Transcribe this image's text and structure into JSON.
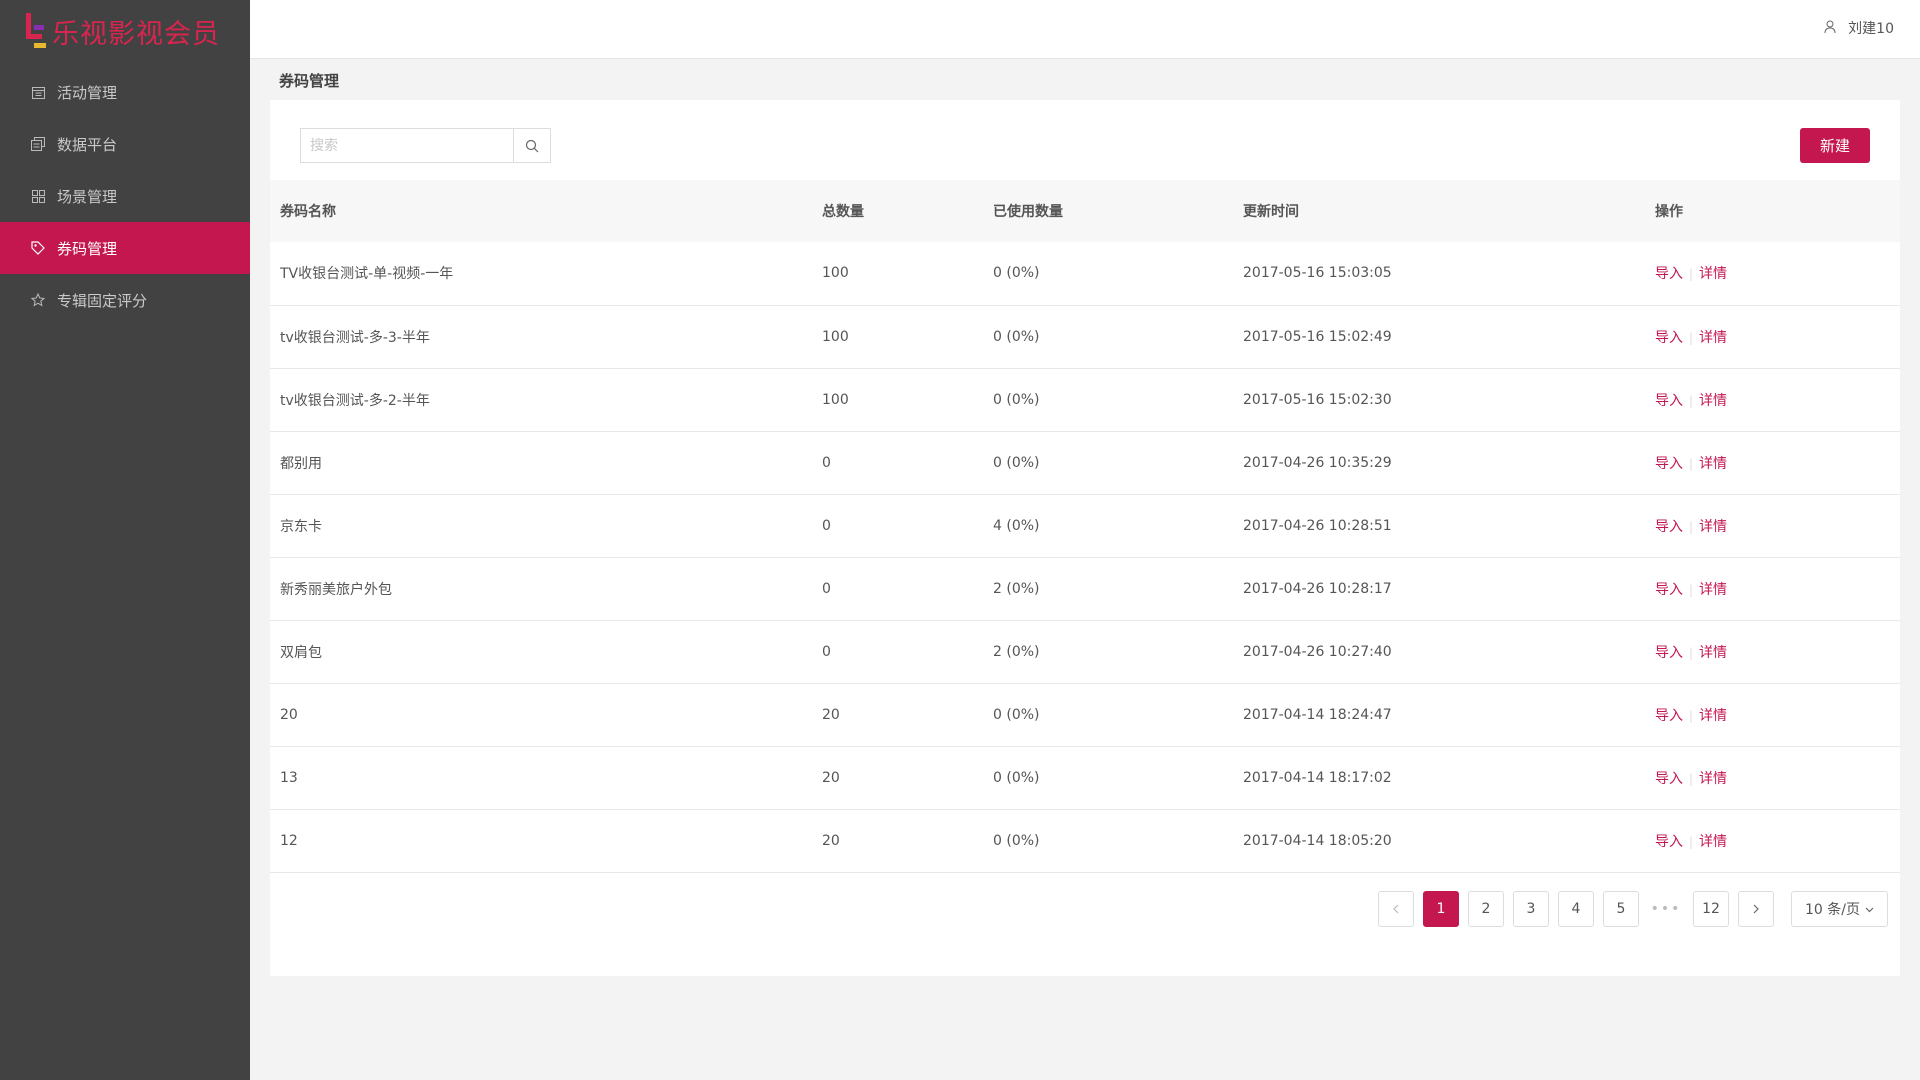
{
  "brand": {
    "logo_text": "乐视影视会员"
  },
  "sidebar": {
    "items": [
      {
        "label": "活动管理",
        "icon": "calendar-icon"
      },
      {
        "label": "数据平台",
        "icon": "layers-icon"
      },
      {
        "label": "场景管理",
        "icon": "grid-icon"
      },
      {
        "label": "券码管理",
        "icon": "tag-icon",
        "active": true
      },
      {
        "label": "专辑固定评分",
        "icon": "star-icon"
      }
    ]
  },
  "header": {
    "user_name": "刘建10"
  },
  "page": {
    "title": "券码管理"
  },
  "toolbar": {
    "search_placeholder": "搜索",
    "new_label": "新建"
  },
  "table": {
    "headers": [
      "券码名称",
      "总数量",
      "已使用数量",
      "更新时间",
      "操作"
    ],
    "rows": [
      {
        "name": "TV收银台测试-单-视频-一年",
        "total": "100",
        "used": "0 (0%)",
        "updated": "2017-05-16 15:03:05"
      },
      {
        "name": "tv收银台测试-多-3-半年",
        "total": "100",
        "used": "0 (0%)",
        "updated": "2017-05-16 15:02:49"
      },
      {
        "name": "tv收银台测试-多-2-半年",
        "total": "100",
        "used": "0 (0%)",
        "updated": "2017-05-16 15:02:30"
      },
      {
        "name": "都别用",
        "total": "0",
        "used": "0 (0%)",
        "updated": "2017-04-26 10:35:29"
      },
      {
        "name": "京东卡",
        "total": "0",
        "used": "4 (0%)",
        "updated": "2017-04-26 10:28:51"
      },
      {
        "name": "新秀丽美旅户外包",
        "total": "0",
        "used": "2 (0%)",
        "updated": "2017-04-26 10:28:17"
      },
      {
        "name": "双肩包",
        "total": "0",
        "used": "2 (0%)",
        "updated": "2017-04-26 10:27:40"
      },
      {
        "name": "20",
        "total": "20",
        "used": "0 (0%)",
        "updated": "2017-04-14 18:24:47"
      },
      {
        "name": "13",
        "total": "20",
        "used": "0 (0%)",
        "updated": "2017-04-14 18:17:02"
      },
      {
        "name": "12",
        "total": "20",
        "used": "0 (0%)",
        "updated": "2017-04-14 18:05:20"
      }
    ],
    "action_import": "导入",
    "action_detail": "详情"
  },
  "pagination": {
    "pages": [
      "1",
      "2",
      "3",
      "4",
      "5"
    ],
    "ellipsis": "•••",
    "last_page": "12",
    "current": "1",
    "page_size": "10 条/页"
  },
  "colors": {
    "accent": "#c4174f",
    "sidebar_bg": "#424242"
  }
}
